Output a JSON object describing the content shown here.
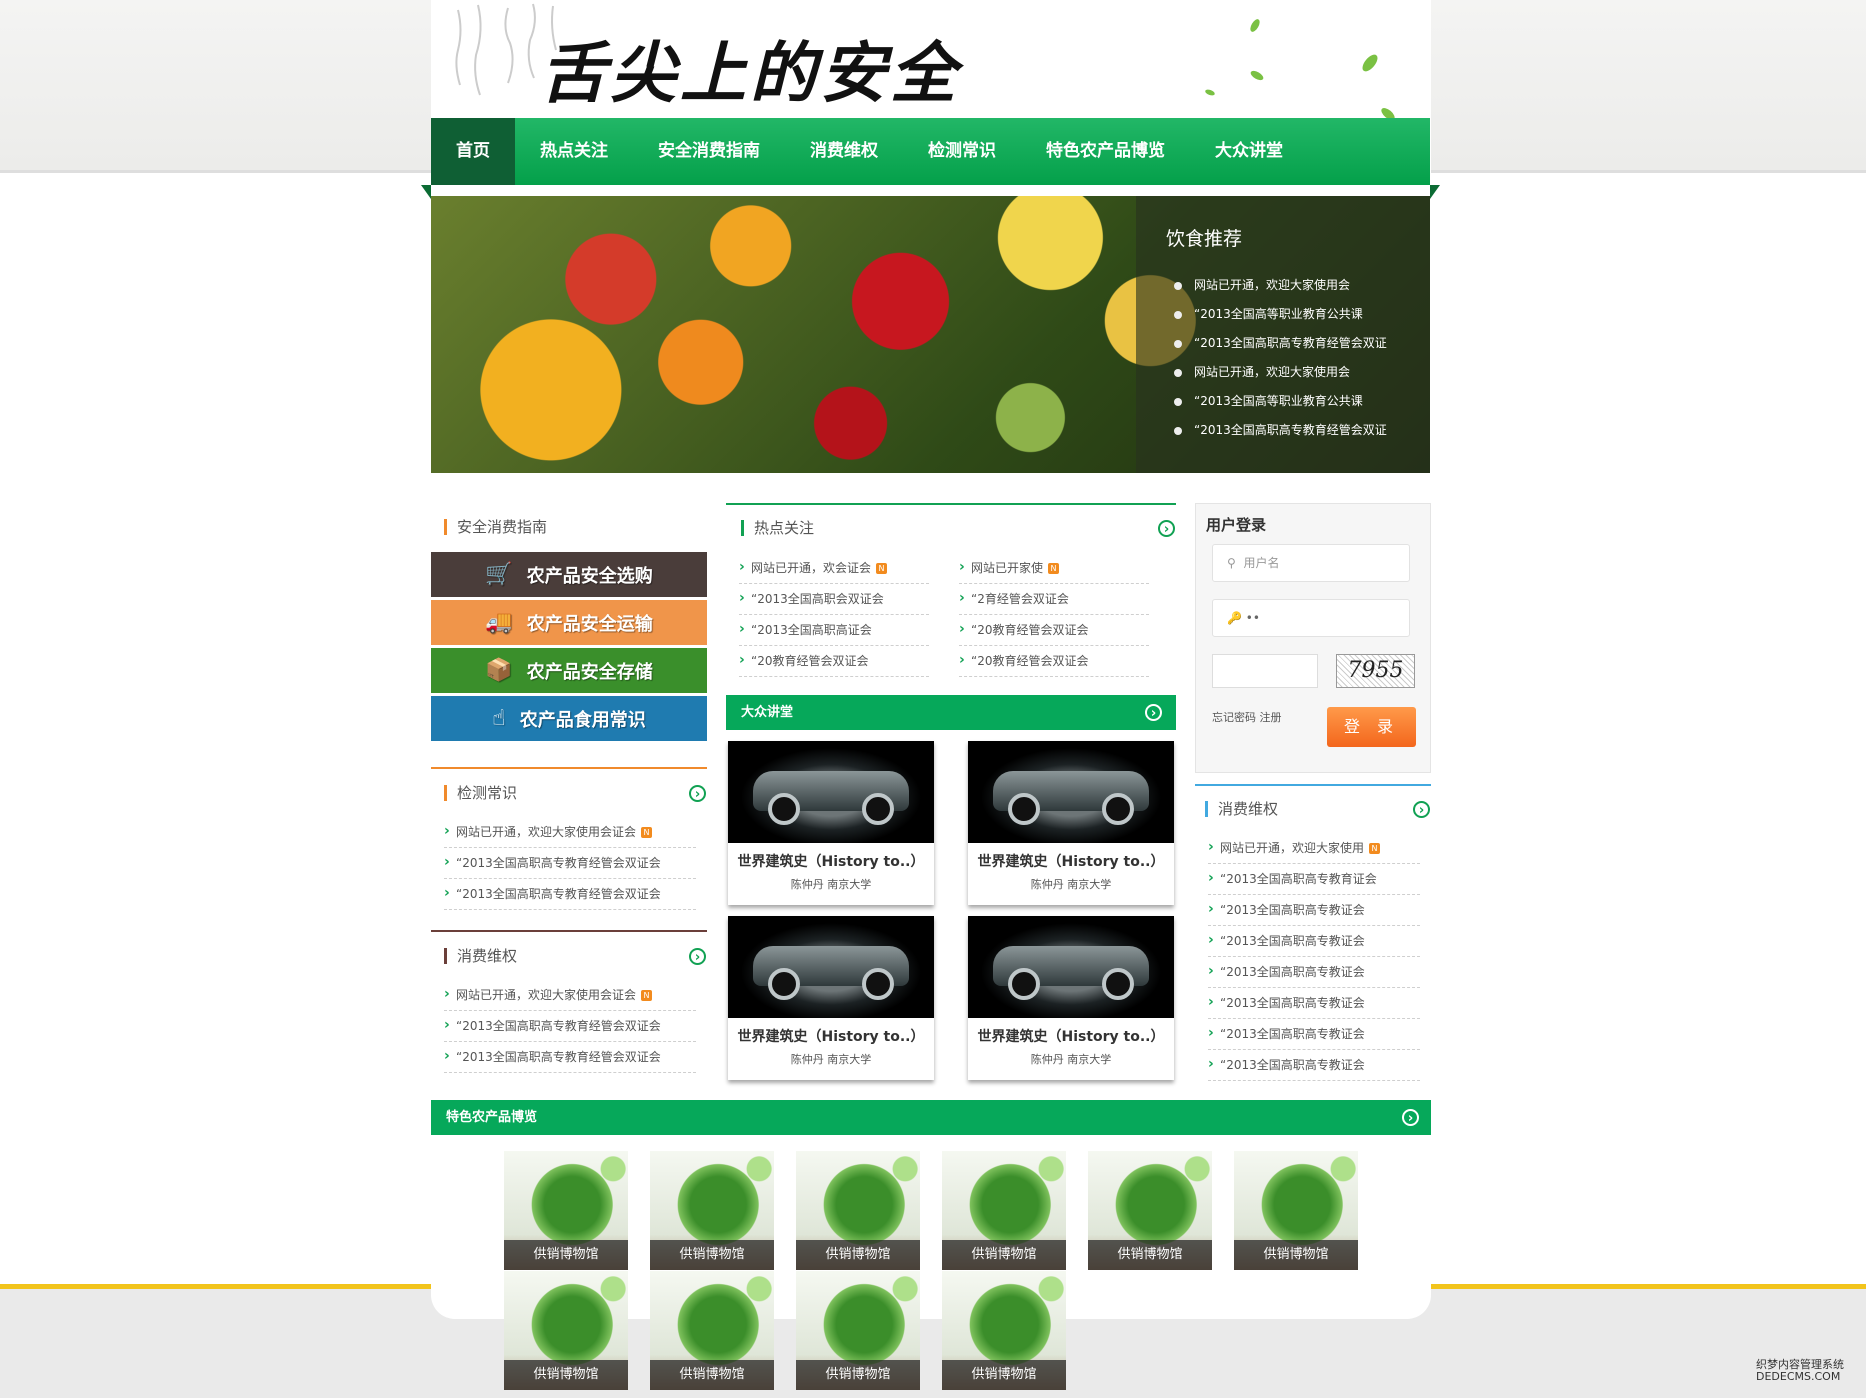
{
  "header": {
    "logo_text": "舌尖上的安全"
  },
  "nav": {
    "items": [
      "首页",
      "热点关注",
      "安全消费指南",
      "消费维权",
      "检测常识",
      "特色农产品博览",
      "大众讲堂"
    ]
  },
  "banner": {
    "rec_title": "饮食推荐",
    "rec_items": [
      "网站已开通，欢迎大家使用会",
      "“2013全国高等职业教育公共课",
      "“2013全国高职高专教育经管会双证",
      "网站已开通，欢迎大家使用会",
      "“2013全国高等职业教育公共课",
      "“2013全国高职高专教育经管会双证"
    ]
  },
  "guide": {
    "title": "安全消费指南",
    "buttons": [
      {
        "label": "农产品安全选购",
        "color": "#4a3d3a",
        "icon": "cart-icon"
      },
      {
        "label": "农产品安全运输",
        "color": "#f0954a",
        "icon": "truck-icon"
      },
      {
        "label": "农产品安全存储",
        "color": "#3a8f2b",
        "icon": "box-icon"
      },
      {
        "label": "农产品食用常识",
        "color": "#1f7bb0",
        "icon": "hand-pointer-icon"
      }
    ]
  },
  "detect": {
    "title": "检测常识",
    "items": [
      "网站已开通，欢迎大家使用会证会",
      "“2013全国高职高专教育经管会双证会",
      "“2013全国高职高专教育经管会双证会"
    ]
  },
  "rights_left": {
    "title": "消费维权",
    "items": [
      "网站已开通，欢迎大家使用会证会",
      "“2013全国高职高专教育经管会双证会",
      "“2013全国高职高专教育经管会双证会"
    ]
  },
  "hot": {
    "title": "热点关注",
    "col1": [
      "网站已开通，欢会证会",
      "“2013全国高职会双证会",
      "“2013全国高职高证会",
      "“20教育经管会双证会"
    ],
    "col2": [
      "网站已开家使",
      "“2育经管会双证会",
      "“20教育经管会双证会",
      "“20教育经管会双证会"
    ]
  },
  "lecture": {
    "title": "大众讲堂",
    "courses": [
      {
        "title": "世界建筑史（History to..）",
        "meta": "陈仲丹   南京大学"
      },
      {
        "title": "世界建筑史（History to..）",
        "meta": "陈仲丹   南京大学"
      },
      {
        "title": "世界建筑史（History to..）",
        "meta": "陈仲丹   南京大学"
      },
      {
        "title": "世界建筑史（History to..）",
        "meta": "陈仲丹   南京大学"
      }
    ]
  },
  "login": {
    "title": "用户登录",
    "username_placeholder": "用户名",
    "password_value": "••",
    "captcha": "7955",
    "links": "忘记密码 注册",
    "button": "登 录"
  },
  "rights_right": {
    "title": "消费维权",
    "items": [
      "网站已开通，欢迎大家使用",
      "“2013全国高职高专教育证会",
      "“2013全国高职高专教证会",
      "“2013全国高职高专教证会",
      "“2013全国高职高专教证会",
      "“2013全国高职高专教证会",
      "“2013全国高职高专教证会",
      "“2013全国高职高专教证会"
    ]
  },
  "special": {
    "title": "特色农产品博览",
    "products": [
      "供销博物馆",
      "供销博物馆",
      "供销博物馆",
      "供销博物馆",
      "供销博物馆",
      "供销博物馆",
      "供销博物馆",
      "供销博物馆",
      "供销博物馆",
      "供销博物馆"
    ]
  },
  "watermark": {
    "line1": "织梦内容管理系统",
    "line2": "DEDECMS.COM"
  }
}
